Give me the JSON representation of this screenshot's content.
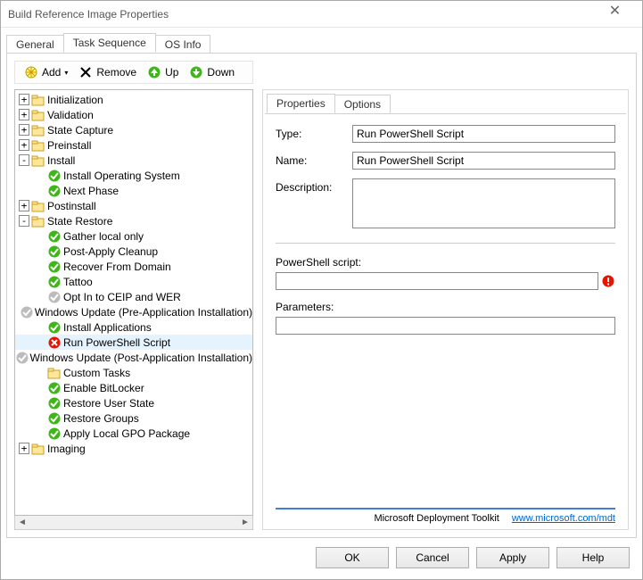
{
  "window": {
    "title": "Build Reference Image Properties"
  },
  "outer_tabs": [
    "General",
    "Task Sequence",
    "OS Info"
  ],
  "outer_tab_active": 1,
  "toolbar": {
    "add": "Add",
    "remove": "Remove",
    "up": "Up",
    "down": "Down"
  },
  "tree": [
    {
      "level": 0,
      "exp": "+",
      "icon": "folder",
      "label": "Initialization"
    },
    {
      "level": 0,
      "exp": "+",
      "icon": "folder",
      "label": "Validation"
    },
    {
      "level": 0,
      "exp": "+",
      "icon": "folder",
      "label": "State Capture"
    },
    {
      "level": 0,
      "exp": "+",
      "icon": "folder",
      "label": "Preinstall"
    },
    {
      "level": 0,
      "exp": "-",
      "icon": "folder",
      "label": "Install"
    },
    {
      "level": 1,
      "exp": "",
      "icon": "check",
      "label": "Install Operating System"
    },
    {
      "level": 1,
      "exp": "",
      "icon": "check",
      "label": "Next Phase"
    },
    {
      "level": 0,
      "exp": "+",
      "icon": "folder",
      "label": "Postinstall"
    },
    {
      "level": 0,
      "exp": "-",
      "icon": "folder",
      "label": "State Restore"
    },
    {
      "level": 1,
      "exp": "",
      "icon": "check",
      "label": "Gather local only"
    },
    {
      "level": 1,
      "exp": "",
      "icon": "check",
      "label": "Post-Apply Cleanup"
    },
    {
      "level": 1,
      "exp": "",
      "icon": "check",
      "label": "Recover From Domain"
    },
    {
      "level": 1,
      "exp": "",
      "icon": "check",
      "label": "Tattoo"
    },
    {
      "level": 1,
      "exp": "",
      "icon": "disabled",
      "label": "Opt In to CEIP and WER"
    },
    {
      "level": 1,
      "exp": "",
      "icon": "disabled",
      "label": "Windows Update (Pre-Application Installation)"
    },
    {
      "level": 1,
      "exp": "",
      "icon": "check",
      "label": "Install Applications"
    },
    {
      "level": 1,
      "exp": "",
      "icon": "error",
      "label": "Run PowerShell Script",
      "selected": true
    },
    {
      "level": 1,
      "exp": "",
      "icon": "disabled",
      "label": "Windows Update (Post-Application Installation)"
    },
    {
      "level": 1,
      "exp": "",
      "icon": "folder",
      "label": "Custom Tasks"
    },
    {
      "level": 1,
      "exp": "",
      "icon": "check",
      "label": "Enable BitLocker"
    },
    {
      "level": 1,
      "exp": "",
      "icon": "check",
      "label": "Restore User State"
    },
    {
      "level": 1,
      "exp": "",
      "icon": "check",
      "label": "Restore Groups"
    },
    {
      "level": 1,
      "exp": "",
      "icon": "check",
      "label": "Apply Local GPO Package"
    },
    {
      "level": 0,
      "exp": "+",
      "icon": "folder",
      "label": "Imaging"
    }
  ],
  "inner_tabs": [
    "Properties",
    "Options"
  ],
  "inner_tab_active": 0,
  "form": {
    "type_label": "Type:",
    "type_value": "Run PowerShell Script",
    "name_label": "Name:",
    "name_value": "Run PowerShell Script",
    "desc_label": "Description:",
    "desc_value": "",
    "script_label": "PowerShell script:",
    "script_value": "",
    "params_label": "Parameters:",
    "params_value": ""
  },
  "brand": {
    "text": "Microsoft Deployment Toolkit",
    "link_text": "www.microsoft.com/mdt"
  },
  "buttons": {
    "ok": "OK",
    "cancel": "Cancel",
    "apply": "Apply",
    "help": "Help"
  }
}
